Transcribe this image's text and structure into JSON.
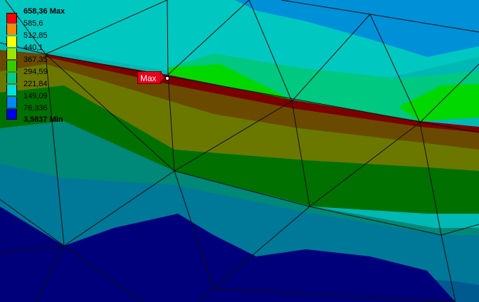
{
  "legend": {
    "max_label": "658,36 Max",
    "min_label": "3,5837 Min",
    "levels": [
      "585,6",
      "512,85",
      "440,1",
      "367,35",
      "294,59",
      "221,84",
      "149,09",
      "76,336"
    ],
    "colors": [
      "#ff0000",
      "#ff8800",
      "#ffff00",
      "#99e600",
      "#33cc00",
      "#00cc88",
      "#00e0e0",
      "#0088ff",
      "#0000ee"
    ]
  },
  "probe": {
    "label": "Max",
    "color": "#e8001a"
  },
  "mesh_colors": {
    "top_light": "#00c8c0",
    "top_blue": "#0090d8",
    "mid_cyan": "#00b8b4",
    "green_band": "#00c880",
    "bright_green": "#00d800",
    "dark_red": "#7a0000",
    "brown": "#6a4a00",
    "olive": "#6a7800",
    "dark_green": "#007000",
    "teal_mid": "#008878",
    "teal_low": "#007898",
    "deep_teal": "#005a90",
    "navy": "#00007a"
  }
}
